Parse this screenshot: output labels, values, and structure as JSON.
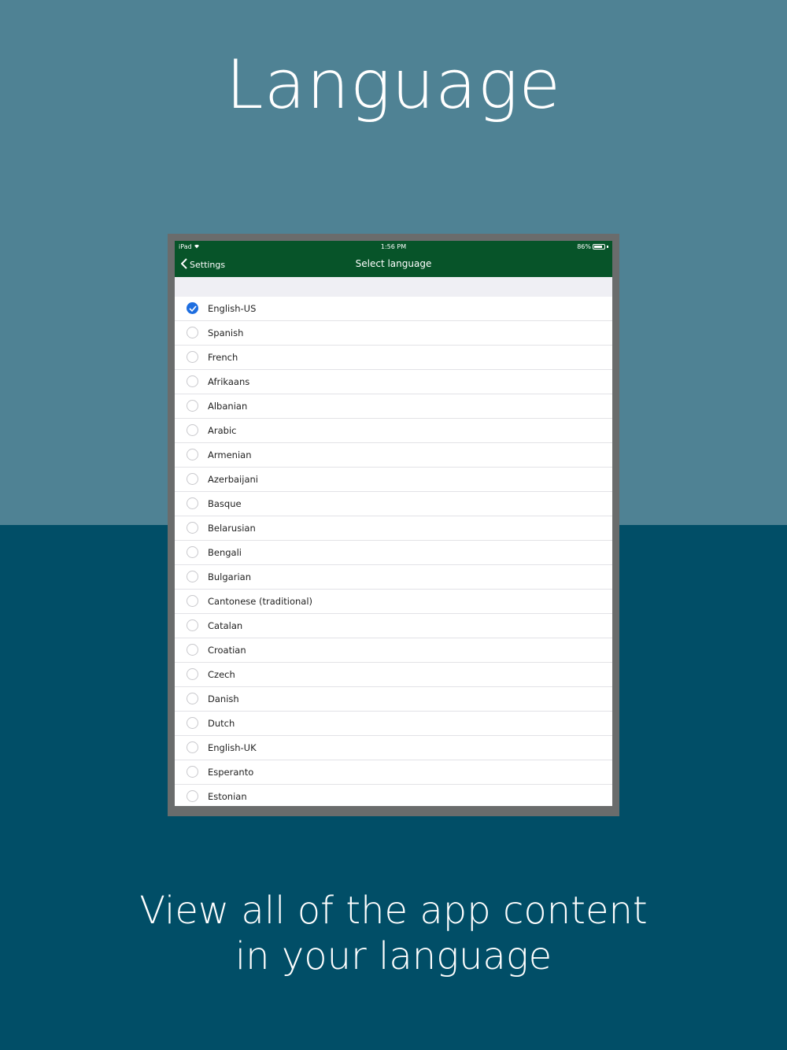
{
  "promo": {
    "headline": "Language",
    "caption_line1": "View all of the app content",
    "caption_line2": "in your language"
  },
  "status_bar": {
    "device": "iPad",
    "time": "1:56 PM",
    "battery": "86%",
    "battery_level": 0.86
  },
  "nav": {
    "back_label": "Settings",
    "title": "Select language"
  },
  "colors": {
    "bg_top": "#4f8294",
    "bg_bottom": "#014e67",
    "navbar": "#075429",
    "checked": "#1e6ee0"
  },
  "languages": [
    {
      "label": "English-US",
      "selected": true
    },
    {
      "label": "Spanish",
      "selected": false
    },
    {
      "label": "French",
      "selected": false
    },
    {
      "label": "Afrikaans",
      "selected": false
    },
    {
      "label": "Albanian",
      "selected": false
    },
    {
      "label": "Arabic",
      "selected": false
    },
    {
      "label": "Armenian",
      "selected": false
    },
    {
      "label": "Azerbaijani",
      "selected": false
    },
    {
      "label": "Basque",
      "selected": false
    },
    {
      "label": "Belarusian",
      "selected": false
    },
    {
      "label": "Bengali",
      "selected": false
    },
    {
      "label": "Bulgarian",
      "selected": false
    },
    {
      "label": "Cantonese (traditional)",
      "selected": false
    },
    {
      "label": "Catalan",
      "selected": false
    },
    {
      "label": "Croatian",
      "selected": false
    },
    {
      "label": "Czech",
      "selected": false
    },
    {
      "label": "Danish",
      "selected": false
    },
    {
      "label": "Dutch",
      "selected": false
    },
    {
      "label": "English-UK",
      "selected": false
    },
    {
      "label": "Esperanto",
      "selected": false
    },
    {
      "label": "Estonian",
      "selected": false
    }
  ]
}
